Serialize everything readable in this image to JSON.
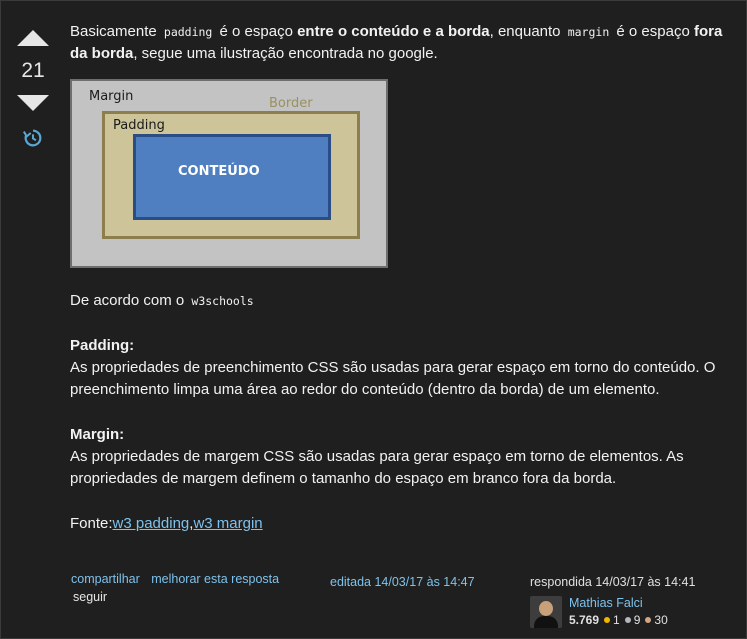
{
  "vote": {
    "count": "21"
  },
  "post": {
    "intro": {
      "t1": "Basicamente ",
      "c1": "padding",
      "t2": " é o espaço ",
      "b1": "entre o conteúdo e a borda",
      "t3": ", enquanto ",
      "c2": "margin",
      "t4": " é o espaço ",
      "b2": "fora da borda",
      "t5": ", segue uma ilustração encontrada no google."
    },
    "figure": {
      "margin_label": "Margin",
      "border_label": "Border",
      "padding_label": "Padding",
      "content_label": "CONTEÚDO"
    },
    "source_line": {
      "text": "De acordo com o ",
      "code": "w3schools"
    },
    "padding_section": {
      "heading": "Padding:",
      "text": "As propriedades de preenchimento CSS são usadas para gerar espaço em torno do conteúdo. O preenchimento limpa uma área ao redor do conteúdo (dentro da borda) de um elemento."
    },
    "margin_section": {
      "heading": "Margin:",
      "text": "As propriedades de margem CSS são usadas para gerar espaço em torno de elementos. As propriedades de margem definem o tamanho do espaço em branco fora da borda."
    },
    "fonte": {
      "label": "Fonte:",
      "link1": "w3 padding",
      "sep": ",",
      "link2": "w3 margin"
    }
  },
  "footer": {
    "share": "compartilhar",
    "improve": "melhorar esta resposta",
    "follow": "seguir",
    "edited": "editada 14/03/17 às 14:47",
    "answered": "respondida 14/03/17 às 14:41",
    "user": {
      "name": "Mathias Falci",
      "reputation": "5.769",
      "gold": "1",
      "silver": "9",
      "bronze": "30"
    }
  },
  "colors": {
    "gold": "#f1b600",
    "silver": "#b4b8bc",
    "bronze": "#d1a684",
    "link": "#7ec2ec"
  }
}
